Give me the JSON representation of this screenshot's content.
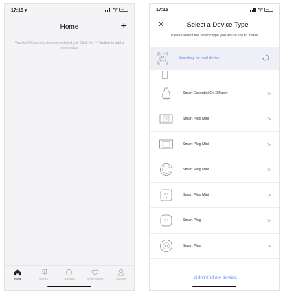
{
  "left": {
    "status": {
      "time": "17:15 ▾"
    },
    "title": "Home",
    "add_symbol": "+",
    "empty_message": "You don't have any devices installed yet. Click the \"+\" button to add a new device.",
    "tabs": [
      {
        "label": "Home",
        "icon": "home-icon"
      },
      {
        "label": "Scenes",
        "icon": "scenes-icon"
      },
      {
        "label": "Routines",
        "icon": "clock-icon"
      },
      {
        "label": "Smart Actions",
        "icon": "heart-icon"
      },
      {
        "label": "Account",
        "icon": "account-icon"
      }
    ]
  },
  "right": {
    "status": {
      "time": "17:15"
    },
    "close_symbol": "✕",
    "title": "Select a Device Type",
    "subtitle": "Please select the device type you would like to install.",
    "searching": "Searching for local device",
    "devices": [
      {
        "name": "Smart Essential Oil Diffuser",
        "icon": "diffuser-icon"
      },
      {
        "name": "Smart Plug Mini",
        "icon": "plug-mini-square-icon"
      },
      {
        "name": "Smart Plug Mini",
        "icon": "plug-mini-wide-icon"
      },
      {
        "name": "Smart Plug Mini",
        "icon": "plug-round-icon"
      },
      {
        "name": "Smart Plug Mini",
        "icon": "plug-square-icon"
      },
      {
        "name": "Smart Plug",
        "icon": "plug-rounded-icon"
      },
      {
        "name": "Smart Plug",
        "icon": "plug-circle-icon"
      }
    ],
    "chevron": ">",
    "not_found": "I didn't find my device."
  },
  "colors": {
    "accent": "#5b8ee6",
    "search_bg": "#eef0f6",
    "battery": "#8bc34a"
  }
}
